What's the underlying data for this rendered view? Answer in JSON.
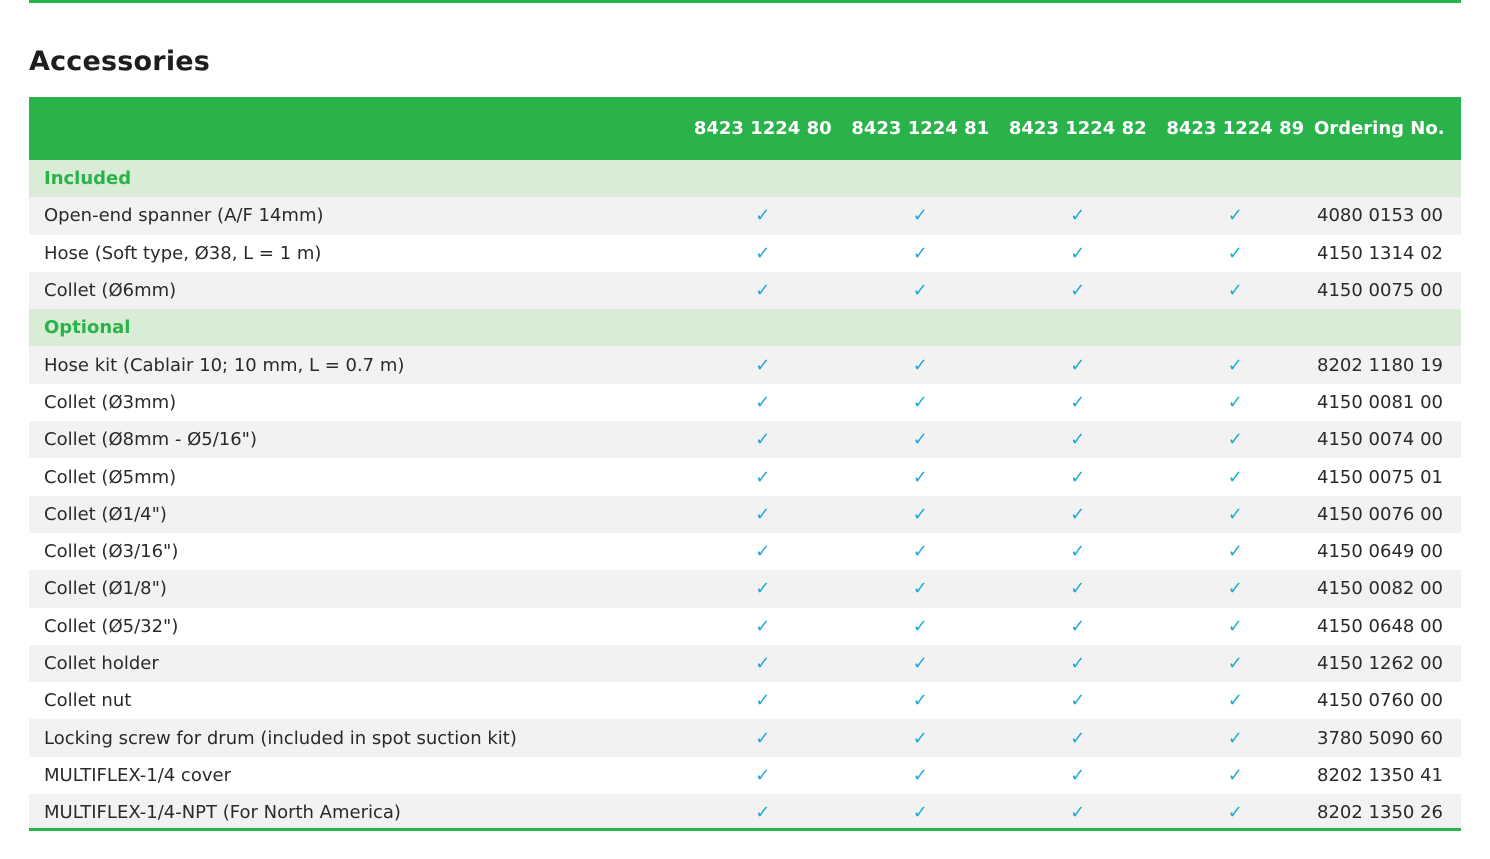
{
  "title": "Accessories",
  "colors": {
    "brand_green": "#29b34a",
    "section_bg": "#d9ecd5",
    "check_blue": "#1eaad2"
  },
  "table": {
    "headers": [
      "",
      "8423 1224 80",
      "8423 1224 81",
      "8423 1224 82",
      "8423 1224 89",
      "Ordering No."
    ],
    "check_mark": "✓",
    "sections": [
      {
        "label": "Included",
        "rows": [
          {
            "description": "Open-end spanner (A/F 14mm)",
            "ordering_no": "4080 0153 00"
          },
          {
            "description": "Hose (Soft type, Ø38, L = 1 m)",
            "ordering_no": "4150 1314 02"
          },
          {
            "description": "Collet (Ø6mm)",
            "ordering_no": "4150 0075 00"
          }
        ]
      },
      {
        "label": "Optional",
        "rows": [
          {
            "description": "Hose kit (Cablair 10; 10 mm, L = 0.7 m)",
            "ordering_no": "8202 1180 19"
          },
          {
            "description": "Collet (Ø3mm)",
            "ordering_no": "4150 0081 00"
          },
          {
            "description": "Collet (Ø8mm - Ø5/16\")",
            "ordering_no": "4150 0074 00"
          },
          {
            "description": "Collet (Ø5mm)",
            "ordering_no": "4150 0075 01"
          },
          {
            "description": "Collet (Ø1/4\")",
            "ordering_no": "4150 0076 00"
          },
          {
            "description": "Collet (Ø3/16\")",
            "ordering_no": "4150 0649 00"
          },
          {
            "description": "Collet (Ø1/8\")",
            "ordering_no": "4150 0082 00"
          },
          {
            "description": "Collet (Ø5/32\")",
            "ordering_no": "4150 0648 00"
          },
          {
            "description": "Collet holder",
            "ordering_no": "4150 1262 00"
          },
          {
            "description": "Collet nut",
            "ordering_no": "4150 0760 00"
          },
          {
            "description": "Locking screw for drum (included in spot suction kit)",
            "ordering_no": "3780 5090 60"
          },
          {
            "description": "MULTIFLEX-1/4 cover",
            "ordering_no": "8202 1350 41"
          },
          {
            "description": "MULTIFLEX-1/4-NPT (For North America)",
            "ordering_no": "8202 1350 26"
          }
        ]
      }
    ]
  }
}
